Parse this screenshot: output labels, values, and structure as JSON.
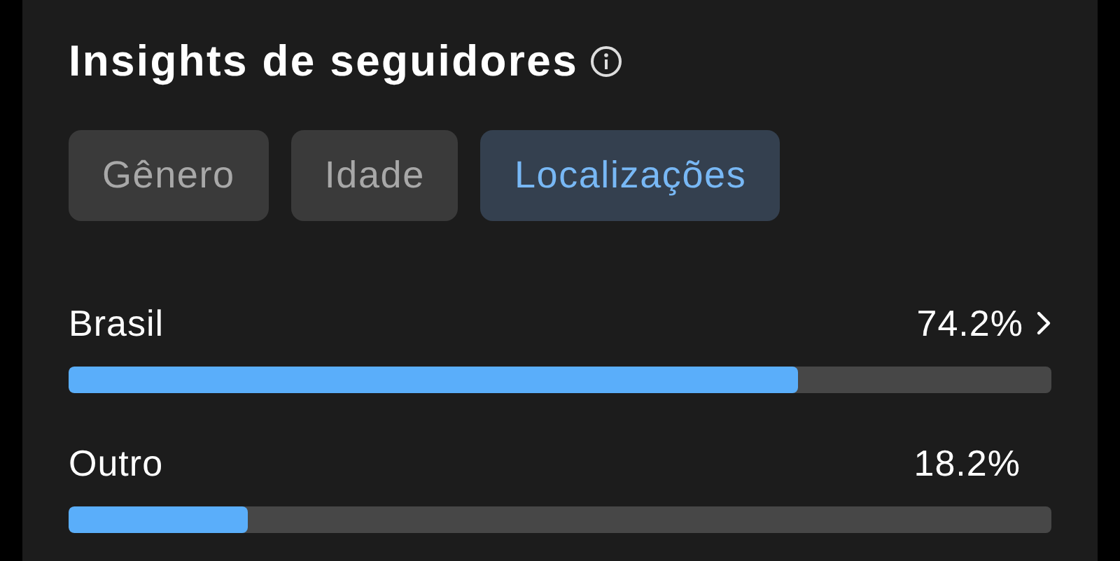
{
  "title": "Insights de seguidores",
  "tabs": [
    {
      "label": "Gênero",
      "selected": false
    },
    {
      "label": "Idade",
      "selected": false
    },
    {
      "label": "Localizações",
      "selected": true
    }
  ],
  "locations": [
    {
      "name": "Brasil",
      "reading": "74.2%",
      "level": 0.742,
      "chevron": true
    },
    {
      "name": "Outro",
      "reading": "18.2%",
      "level": 0.182,
      "chevron": false
    }
  ]
}
